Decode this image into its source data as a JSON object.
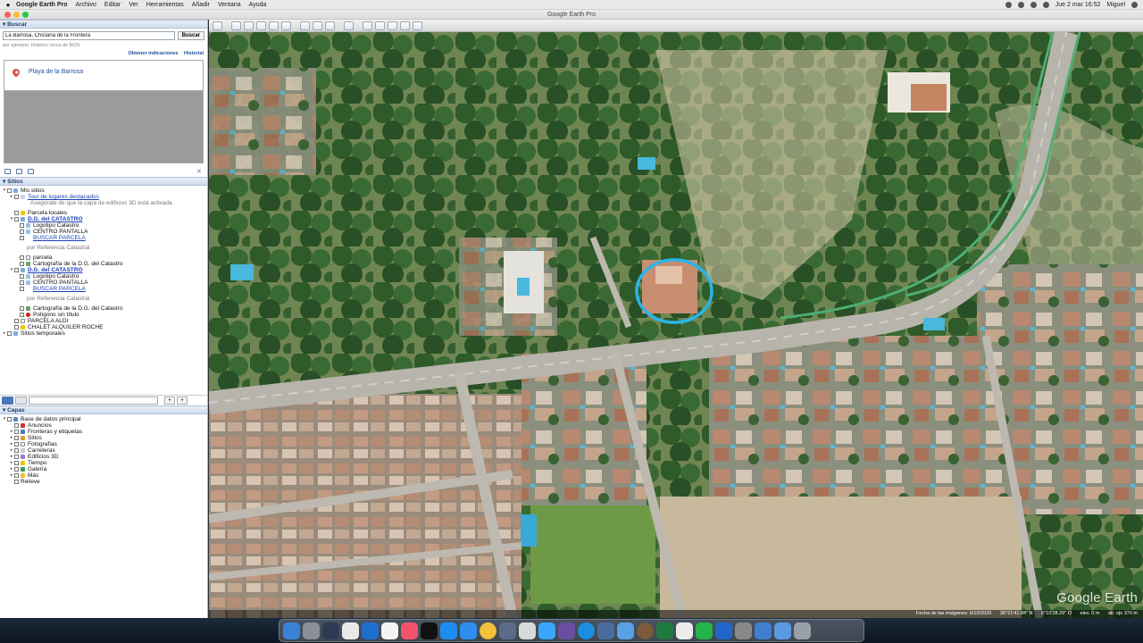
{
  "menubar": {
    "app": "Google Earth Pro",
    "items": [
      "Archivo",
      "Editar",
      "Ver",
      "Herramientas",
      "Añadir",
      "Ventana",
      "Ayuda"
    ],
    "clock": "Jue 2 mar 16:52",
    "user": "Miguel"
  },
  "window": {
    "title": "Google Earth Pro"
  },
  "search": {
    "header": "▾ Buscar",
    "query": "La Barrosa, Chiclana de la Frontera",
    "button": "Buscar",
    "hint": "por ejemplo: Hoteles cerca de BCN",
    "link_directions": "Obtener indicaciones",
    "link_history": "Historial",
    "result": "Playa de la Barrosa"
  },
  "places": {
    "header": "▾ Sitios",
    "my_places": "Mis sitios",
    "tour": "Tour de lugares destacados",
    "tour_note": "Asegúrate de que la capa de edificios 3D está activada.",
    "parcela_locales": "Parcela locales",
    "dg_catastro_1": "D.G. del CATASTRO",
    "logotipo_1": "Logotipo Catastro",
    "centro_1": "CENTRO PANTALLA",
    "buscar_1": "BUSCAR PARCELA",
    "ref_1": "por Referencia Catastral",
    "parcela": "parcela",
    "cartografia_1": "Cartografía de la D.G. del Catastro",
    "dg_catastro_2": "D.G. del CATASTRO",
    "logotipo_2": "Logotipo Catastro",
    "centro_2": "CENTRO PANTALLA",
    "buscar_2": "BUSCAR PARCELA",
    "ref_2": "por Referencia Catastral",
    "cartografia_2": "Cartografía de la D.G. del Catastro",
    "poligono": "Polígono sin título",
    "aldi": "PARCELA ALDI",
    "chalet": "CHALET ALQUILER ROCHE",
    "temporales": "Sitios temporales"
  },
  "layers": {
    "header": "▾ Capas",
    "items": [
      "Base de datos principal",
      "Anuncios",
      "Fronteras y etiquetas",
      "Sitios",
      "Fotografías",
      "Carreteras",
      "Edificios 3D",
      "Tiempo",
      "Galería",
      "Más",
      "Relieve"
    ]
  },
  "map": {
    "watermark": "Google Earth",
    "imagery_date": "Fecha de las imágenes: 6/10/2020",
    "lat": "36°21'41.84\" N",
    "lon": "6°10'28.29\" O",
    "elev": "elev.   0 m",
    "alt": "alt. ojo   370 m",
    "highlight_color": "#29b6e8"
  },
  "colors": {
    "accent": "#1a4f9c",
    "link": "#1a3fb8"
  }
}
